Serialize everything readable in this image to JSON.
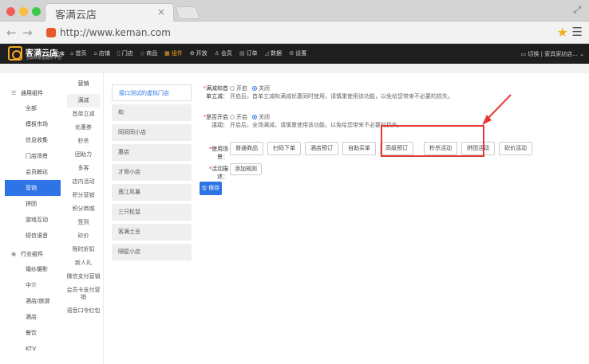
{
  "browser": {
    "tab_title": "客满云店",
    "tab_close": "×",
    "url": "http://www.keman.com",
    "expand_glyph": "⤢",
    "back_glyph": "←",
    "forward_glyph": "→",
    "star_glyph": "★",
    "menu_glyph": "☰"
  },
  "app_nav": {
    "logo_name": "客满云店",
    "logo_sub": "互联网零售服务平台",
    "mini_program": "小程序",
    "menu": [
      {
        "icon": "⌂",
        "label": "首页",
        "active": false
      },
      {
        "icon": "⌂",
        "label": "店铺",
        "active": false
      },
      {
        "icon": "▯",
        "label": "门店",
        "active": false
      },
      {
        "icon": "◇",
        "label": "商品",
        "active": false
      },
      {
        "icon": "▦",
        "label": "组件",
        "active": true
      },
      {
        "icon": "✿",
        "label": "开放",
        "active": false
      },
      {
        "icon": "♙",
        "label": "会员",
        "active": false
      },
      {
        "icon": "▤",
        "label": "订单",
        "active": false
      },
      {
        "icon": "◿",
        "label": "数据",
        "active": false
      },
      {
        "icon": "⚙",
        "label": "设置",
        "active": false
      }
    ],
    "switch_label": "切换",
    "shop_name": "家具家纺店..."
  },
  "sidebar1": {
    "groups": [
      {
        "title": "通用组件",
        "items": [
          {
            "label": "全部",
            "active": false
          },
          {
            "label": "模板市场",
            "active": false
          },
          {
            "label": "信息收集",
            "active": false
          },
          {
            "label": "门店场景",
            "active": false
          },
          {
            "label": "会员触达",
            "active": false
          },
          {
            "label": "营销",
            "active": true
          },
          {
            "label": "拼团",
            "active": false
          },
          {
            "label": "游戏互动",
            "active": false
          },
          {
            "label": "短信语音",
            "active": false
          }
        ]
      },
      {
        "title": "行业组件",
        "items": [
          {
            "label": "婚纱摄影",
            "active": false
          },
          {
            "label": "中介",
            "active": false
          },
          {
            "label": "酒店/旅游",
            "active": false
          },
          {
            "label": "酒店",
            "active": false
          },
          {
            "label": "餐饮",
            "active": false
          },
          {
            "label": "KTV",
            "active": false
          }
        ]
      }
    ]
  },
  "sidebar2": {
    "title": "营销",
    "items": [
      {
        "label": "满减",
        "active": true
      },
      {
        "label": "首单立减",
        "active": false
      },
      {
        "label": "优惠券",
        "active": false
      },
      {
        "label": "秒杀",
        "active": false
      },
      {
        "label": "团助力",
        "active": false
      },
      {
        "label": "多客",
        "active": false
      },
      {
        "label": "店内活动",
        "active": false
      },
      {
        "label": "积分营销",
        "active": false
      },
      {
        "label": "积分商城",
        "active": false
      },
      {
        "label": "签到",
        "active": false
      },
      {
        "label": "砍价",
        "active": false
      },
      {
        "label": "限时折扣",
        "active": false
      },
      {
        "label": "新人礼",
        "active": false
      },
      {
        "label": "微信支付营销",
        "active": false
      },
      {
        "label": "会员卡支付营销",
        "active": false
      },
      {
        "label": "语音口令红包",
        "active": false
      }
    ]
  },
  "stores": [
    {
      "label": "接口测试的虚拟门店",
      "active": true
    },
    {
      "label": "和",
      "active": false
    },
    {
      "label": "同同同小店",
      "active": false
    },
    {
      "label": "惠店",
      "active": false
    },
    {
      "label": "才哥小店",
      "active": false
    },
    {
      "label": "茵江风暴",
      "active": false
    },
    {
      "label": "三只松鼠",
      "active": false
    },
    {
      "label": "客满土豆",
      "active": false
    },
    {
      "label": "隔壁小店",
      "active": false
    }
  ],
  "form": {
    "rows": [
      {
        "label": "满减和首单立减：",
        "on_label": "开启",
        "off_label": "关闭",
        "selected": "off",
        "desc": "开启后，首单立减和满减优惠同时使用，请慎重使用该功能，以免给您带来不必要的损失。"
      },
      {
        "label": "是否开启活动：",
        "on_label": "开启",
        "off_label": "关闭",
        "selected": "off",
        "desc": "开启后，全场满减，请慎重使用该功能，以免给您带来不必要的损失。"
      }
    ],
    "scene_label": "使用场景：",
    "scenes": [
      "普通商品",
      "扫码下单",
      "酒店预订",
      "自助买单",
      "高级预订",
      "秒杀活动",
      "拼团活动",
      "砍价活动"
    ],
    "desc_label": "活动描述：",
    "add_desc_label": "添加规则",
    "save_label": "保存",
    "save_icon": "🖫"
  },
  "colors": {
    "accent": "#2f74e6",
    "highlight": "#e53935",
    "nav_bg": "#1e1e1e",
    "nav_active": "#f5a623"
  }
}
